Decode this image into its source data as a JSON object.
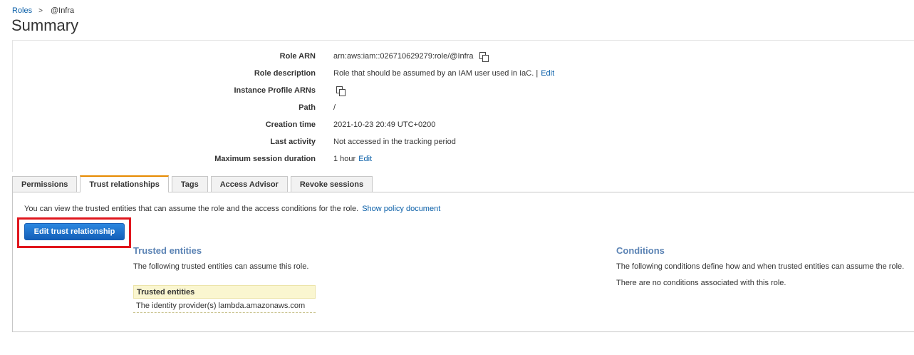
{
  "breadcrumb": {
    "root": "Roles",
    "separator": ">",
    "current": "@Infra"
  },
  "page_title": "Summary",
  "summary": {
    "role_arn": {
      "label": "Role ARN",
      "value": "arn:aws:iam::026710629279:role/@Infra"
    },
    "role_description": {
      "label": "Role description",
      "value": "Role that should be assumed by an IAM user used in IaC. |",
      "edit": "Edit"
    },
    "instance_profile_arns": {
      "label": "Instance Profile ARNs"
    },
    "path": {
      "label": "Path",
      "value": "/"
    },
    "creation_time": {
      "label": "Creation time",
      "value": "2021-10-23 20:49 UTC+0200"
    },
    "last_activity": {
      "label": "Last activity",
      "value": "Not accessed in the tracking period"
    },
    "max_session": {
      "label": "Maximum session duration",
      "value": "1 hour",
      "edit": "Edit"
    }
  },
  "tabs": [
    {
      "label": "Permissions",
      "active": false
    },
    {
      "label": "Trust relationships",
      "active": true
    },
    {
      "label": "Tags",
      "active": false
    },
    {
      "label": "Access Advisor",
      "active": false
    },
    {
      "label": "Revoke sessions",
      "active": false
    }
  ],
  "trust": {
    "intro": "You can view the trusted entities that can assume the role and the access conditions for the role.",
    "show_policy": "Show policy document",
    "edit_button": "Edit trust relationship",
    "entities_title": "Trusted entities",
    "entities_desc": "The following trusted entities can assume this role.",
    "table_header": "Trusted entities",
    "table_rows": [
      "The identity provider(s) lambda.amazonaws.com"
    ],
    "conditions_title": "Conditions",
    "conditions_desc": "The following conditions define how and when trusted entities can assume the role.",
    "conditions_none": "There are no conditions associated with this role."
  },
  "colors": {
    "link": "#0a5fa8",
    "button": "#1a6fcc",
    "highlight": "#e0161d",
    "active_tab": "#e68a00"
  }
}
